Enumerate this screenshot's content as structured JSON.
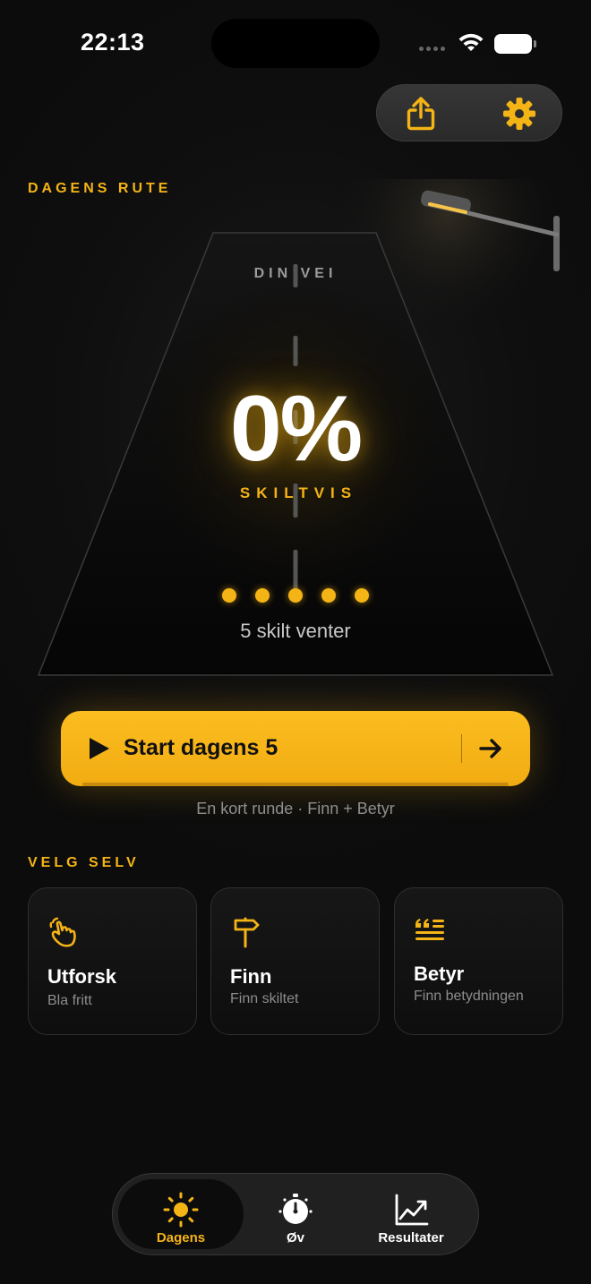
{
  "status_bar": {
    "time": "22:13"
  },
  "section_route": {
    "label": "DAGENS RUTE"
  },
  "road": {
    "top_label": "DIN VEI",
    "percent": "0%",
    "rank": "SKILTVIS",
    "dots_count": 5,
    "waiting_text": "5 skilt venter"
  },
  "start": {
    "label": "Start dagens 5",
    "subtitle": "En kort runde · Finn + Betyr"
  },
  "section_choose": {
    "label": "VELG SELV"
  },
  "cards": [
    {
      "title": "Utforsk",
      "subtitle": "Bla fritt",
      "icon": "hand-pointer-icon"
    },
    {
      "title": "Finn",
      "subtitle": "Finn skiltet",
      "icon": "signpost-icon"
    },
    {
      "title": "Betyr",
      "subtitle": "Finn betydningen",
      "icon": "quote-text-icon"
    }
  ],
  "tabs": [
    {
      "label": "Dagens",
      "icon": "sun-icon",
      "active": true
    },
    {
      "label": "Øv",
      "icon": "timer-icon",
      "active": false
    },
    {
      "label": "Resultater",
      "icon": "chart-icon",
      "active": false
    }
  ],
  "colors": {
    "accent": "#f5b416",
    "background": "#0d0d0d"
  }
}
